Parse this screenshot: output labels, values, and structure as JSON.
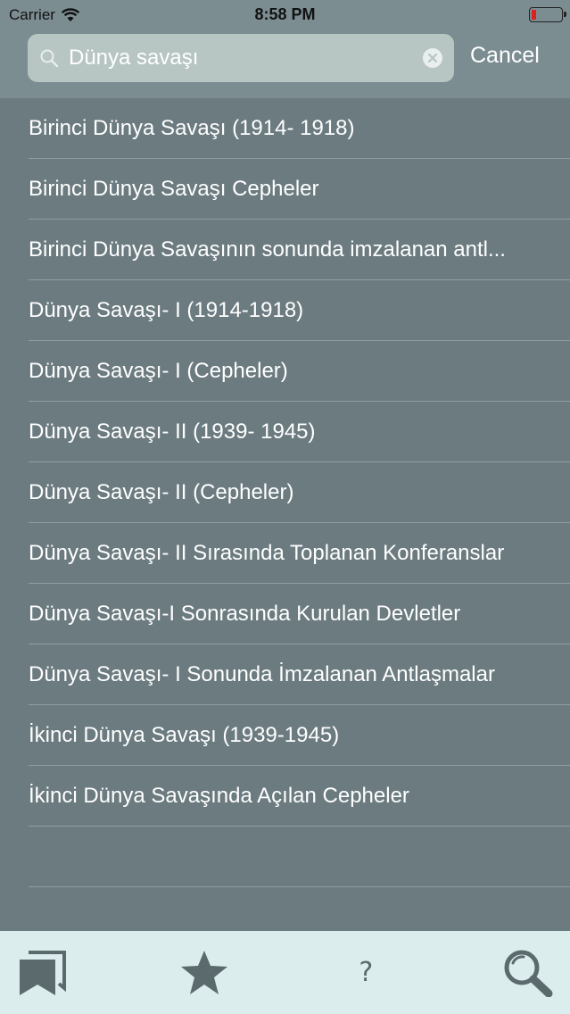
{
  "status_bar": {
    "carrier": "Carrier",
    "time": "8:58 PM"
  },
  "search": {
    "value": "Dünya savaşı",
    "cancel_label": "Cancel"
  },
  "results": [
    {
      "label": "Birinci Dünya Savaşı (1914- 1918)"
    },
    {
      "label": "Birinci Dünya Savaşı Cepheler"
    },
    {
      "label": "Birinci Dünya Savaşının sonunda imzalanan antl..."
    },
    {
      "label": "Dünya Savaşı- I (1914-1918)"
    },
    {
      "label": "Dünya Savaşı- I (Cepheler)"
    },
    {
      "label": "Dünya Savaşı- II (1939- 1945)"
    },
    {
      "label": "Dünya Savaşı- II (Cepheler)"
    },
    {
      "label": "Dünya Savaşı- II Sırasında Toplanan Konferanslar"
    },
    {
      "label": "Dünya Savaşı-I Sonrasında Kurulan Devletler"
    },
    {
      "label": "Dünya Savaşı- I Sonunda İmzalanan Antlaşmalar"
    },
    {
      "label": "İkinci Dünya Savaşı (1939-1945)"
    },
    {
      "label": "İkinci Dünya Savaşında Açılan Cepheler"
    }
  ],
  "tab_bar": {
    "tabs": [
      {
        "icon": "bookmarks-icon"
      },
      {
        "icon": "star-icon"
      },
      {
        "icon": "question-icon",
        "glyph": "?"
      },
      {
        "icon": "search-icon"
      }
    ]
  },
  "colors": {
    "background": "#6b7b80",
    "header": "#7c8d92",
    "search_field": "#b8c6c3",
    "tab_bar": "#dcedee",
    "tab_icon": "#5b6a6d",
    "battery_low": "#e0201b"
  }
}
